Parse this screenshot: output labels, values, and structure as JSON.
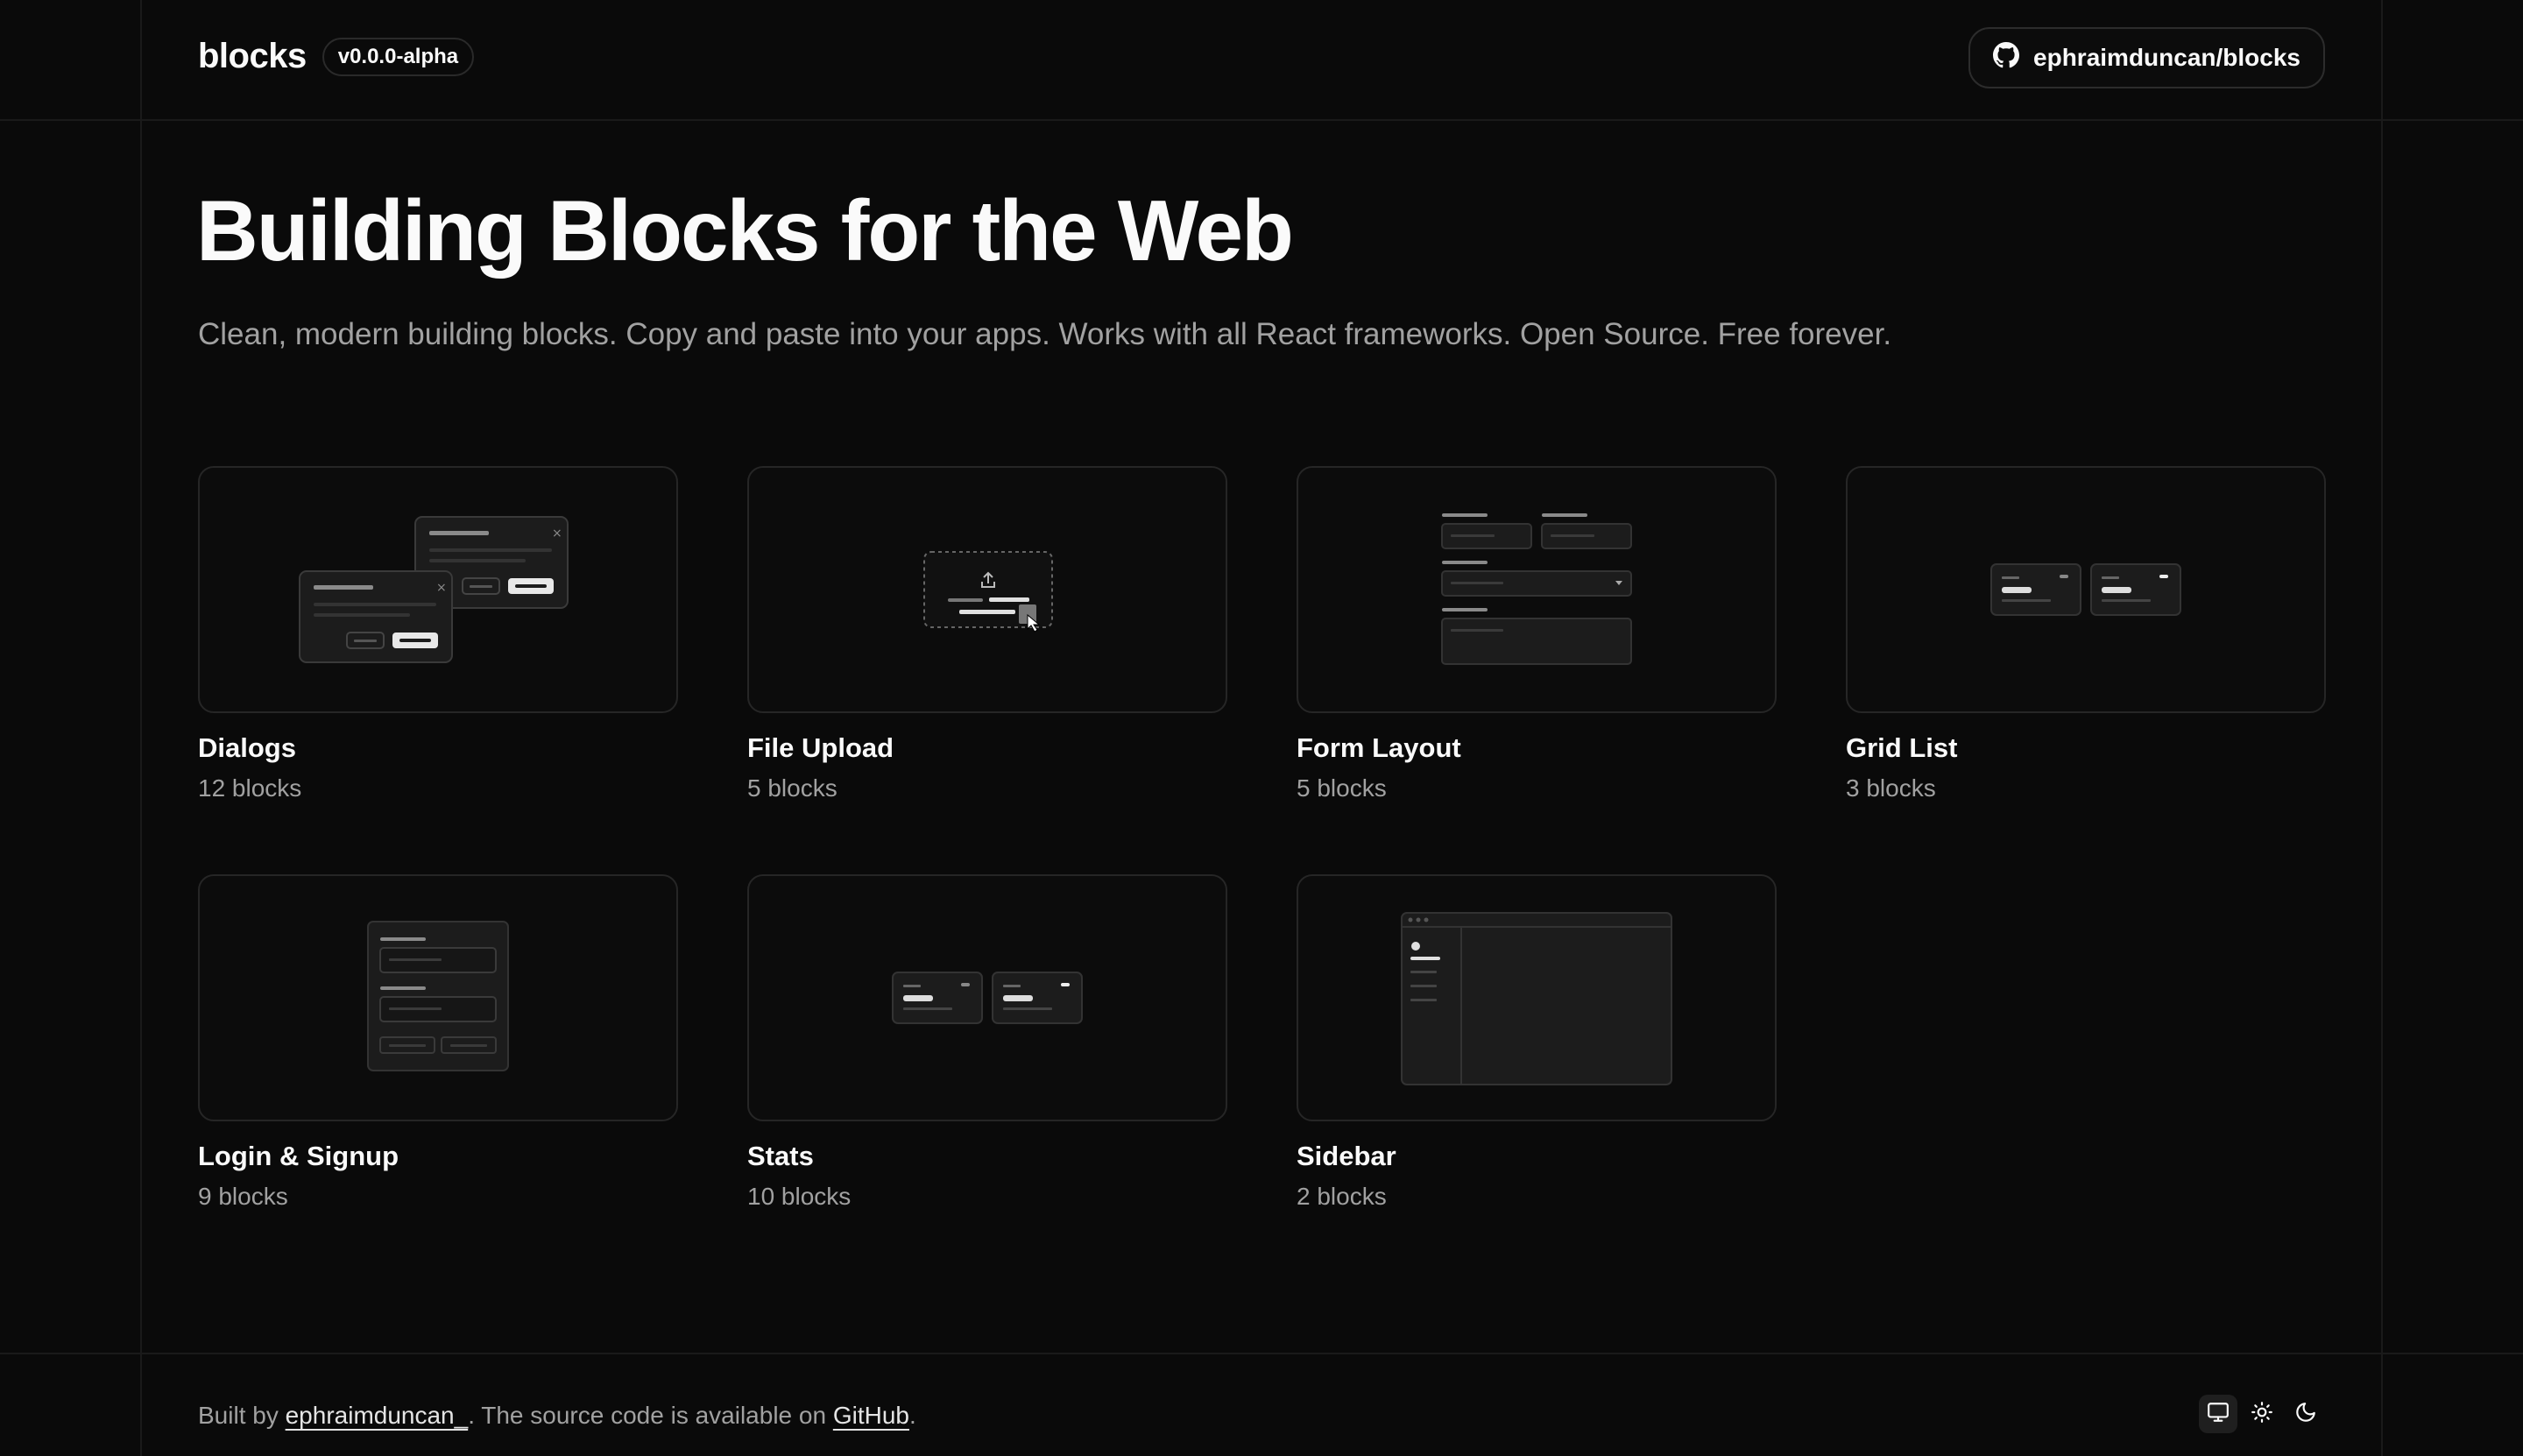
{
  "header": {
    "brand": "blocks",
    "version": "v0.0.0-alpha",
    "github_label": "ephraimduncan/blocks",
    "github_icon": "github-icon"
  },
  "hero": {
    "title": "Building Blocks for the Web",
    "subtitle": "Clean, modern building blocks. Copy and paste into your apps. Works with all React frameworks. Open Source. Free forever."
  },
  "categories": [
    {
      "title": "Dialogs",
      "count": "12 blocks"
    },
    {
      "title": "File Upload",
      "count": "5 blocks"
    },
    {
      "title": "Form Layout",
      "count": "5 blocks"
    },
    {
      "title": "Grid List",
      "count": "3 blocks"
    },
    {
      "title": "Login & Signup",
      "count": "9 blocks"
    },
    {
      "title": "Stats",
      "count": "10 blocks"
    },
    {
      "title": "Sidebar",
      "count": "2 blocks"
    }
  ],
  "footer": {
    "prefix": "Built by ",
    "author": "ephraimduncan_",
    "middle": ". The source code is available on ",
    "github": "GitHub",
    "suffix": "."
  },
  "theme": {
    "options": [
      "system",
      "light",
      "dark"
    ],
    "selected": "system"
  },
  "colors": {
    "background": "#0a0a0a",
    "text": "#fafafa",
    "muted": "#a1a1a1",
    "border": "#262626"
  }
}
